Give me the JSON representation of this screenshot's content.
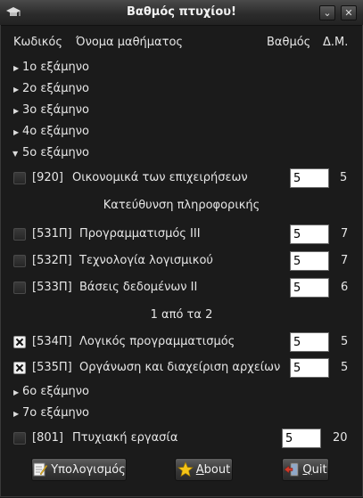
{
  "window": {
    "title": "Βαθμός πτυχίου!",
    "controls": [
      "⌄",
      "✕"
    ]
  },
  "header": {
    "code_col": "Κωδικός",
    "name_col": "Όνομα μαθήματος",
    "grade_col": "Βαθμός",
    "ects_col": "Δ.Μ."
  },
  "semesters": [
    {
      "label": "1ο εξάμηνο",
      "expanded": false
    },
    {
      "label": "2ο εξάμηνο",
      "expanded": false
    },
    {
      "label": "3ο εξάμηνο",
      "expanded": false
    },
    {
      "label": "4ο εξάμηνο",
      "expanded": false
    },
    {
      "label": "5ο εξάμηνο",
      "expanded": true
    },
    {
      "label": "6ο εξάμηνο",
      "expanded": false
    },
    {
      "label": "7ο εξάμηνο",
      "expanded": false
    }
  ],
  "courses": [
    {
      "code": "[920]",
      "name": "Οικονομικά των επιχειρήσεων",
      "grade": "5",
      "ects": "5",
      "checked": false
    },
    {
      "code": "[531Π]",
      "name": "Προγραμματισμός ΙΙΙ",
      "grade": "5",
      "ects": "7",
      "checked": false
    },
    {
      "code": "[532Π]",
      "name": "Τεχνολογία λογισμικού",
      "grade": "5",
      "ects": "7",
      "checked": false
    },
    {
      "code": "[533Π]",
      "name": "Βάσεις δεδομένων ΙΙ",
      "grade": "5",
      "ects": "6",
      "checked": false
    },
    {
      "code": "[534Π]",
      "name": "Λογικός προγραμματισμός",
      "grade": "5",
      "ects": "5",
      "checked": true
    },
    {
      "code": "[535Π]",
      "name": "Οργάνωση και διαχείριση αρχείων",
      "grade": "5",
      "ects": "5",
      "checked": true
    },
    {
      "code": "[801]",
      "name": "Πτυχιακή εργασία",
      "grade": "5",
      "ects": "20",
      "checked": false
    }
  ],
  "sections": {
    "direction": "Κατεύθυνση πληροφορικής",
    "choice": "1 από τα 2"
  },
  "buttons": {
    "calculate": "Υπολογισμός",
    "about_mnemonic": "A",
    "about_rest": "bout",
    "quit_mnemonic": "Q",
    "quit_rest": "uit"
  },
  "colors": {
    "background": "#1b1b1b",
    "text": "#e6e6e6",
    "entry_bg": "#ffffff"
  }
}
